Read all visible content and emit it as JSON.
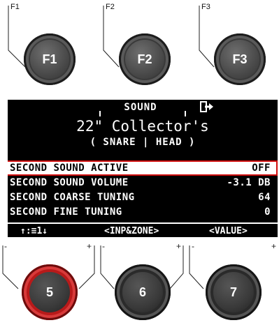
{
  "function_buttons": [
    {
      "callout": "F1",
      "label": "F1"
    },
    {
      "callout": "F2",
      "label": "F2"
    },
    {
      "callout": "F3",
      "label": "F3"
    }
  ],
  "display": {
    "header_title": "SOUND",
    "exit_icon": "exit-arrow-icon",
    "kit_name": "22\" Collector's",
    "subtitle": "( SNARE | HEAD )",
    "rows": [
      {
        "label": "SECOND SOUND ACTIVE",
        "value": "OFF",
        "selected": true
      },
      {
        "label": "SECOND SOUND VOLUME",
        "value": "-3.1 DB",
        "selected": false
      },
      {
        "label": "SECOND COARSE TUNING",
        "value": "64",
        "selected": false
      },
      {
        "label": "SECOND FINE TUNING",
        "value": "0",
        "selected": false
      }
    ],
    "bottom_bar": {
      "left": "↑:≡1↓",
      "middle": "<INP&ZONE>",
      "right": "<VALUE>"
    }
  },
  "knobs": [
    {
      "label": "5",
      "minus": "-",
      "plus": "+",
      "active": true
    },
    {
      "label": "6",
      "minus": "-",
      "plus": "+",
      "active": false
    },
    {
      "label": "7",
      "minus": "-",
      "plus": "+",
      "active": false
    }
  ],
  "colors": {
    "highlight": "#d00d0d",
    "display_bg": "#000000",
    "active_knob": "#b81a1a"
  }
}
